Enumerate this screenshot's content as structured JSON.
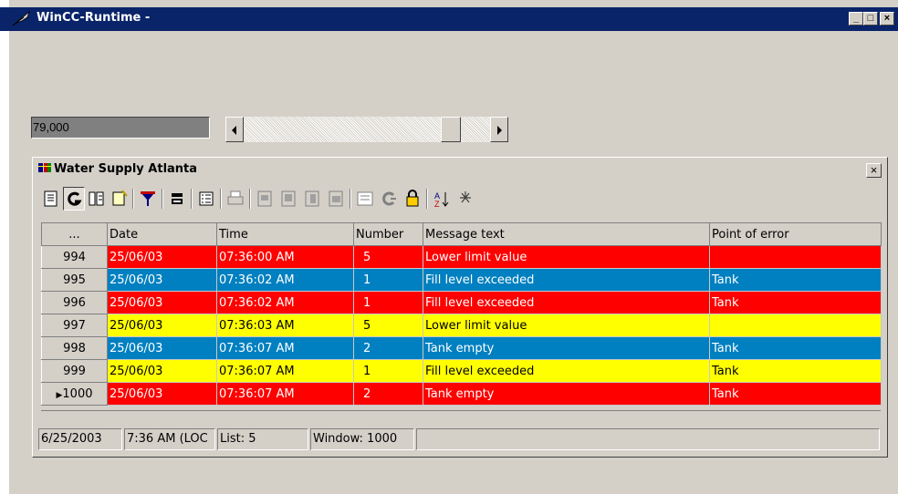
{
  "window": {
    "title": "WinCC-Runtime -",
    "minimize": "_",
    "maximize": "□",
    "close": "×"
  },
  "value_display": "79,000",
  "slider": {
    "value_fraction": 0.8
  },
  "alarm_window": {
    "title": "Water Supply Atlanta",
    "close": "×",
    "toolbar": [
      "message-list-icon",
      "history-icon",
      "journal-icon",
      "hitlist-icon",
      "filter-icon",
      "acknowledge-icon",
      "selection-icon",
      "print-icon",
      "lock-icon-1",
      "lock-icon-2",
      "lock-icon-3",
      "lock-icon-4",
      "report-icon",
      "loop-icon",
      "key-icon",
      "sort-icon",
      "timebase-icon"
    ],
    "columns": [
      "...",
      "Date",
      "Time",
      "Number",
      "Message text",
      "Point of error"
    ],
    "rows": [
      {
        "no": "994",
        "date": "25/06/03",
        "time": "07:36:00 AM",
        "number": "5",
        "text": "Lower limit value",
        "point": "",
        "color": "red"
      },
      {
        "no": "995",
        "date": "25/06/03",
        "time": "07:36:02 AM",
        "number": "1",
        "text": "Fill level exceeded",
        "point": "Tank",
        "color": "blue"
      },
      {
        "no": "996",
        "date": "25/06/03",
        "time": "07:36:02 AM",
        "number": "1",
        "text": "Fill level exceeded",
        "point": "Tank",
        "color": "red"
      },
      {
        "no": "997",
        "date": "25/06/03",
        "time": "07:36:03 AM",
        "number": "5",
        "text": "Lower limit value",
        "point": "",
        "color": "yellow"
      },
      {
        "no": "998",
        "date": "25/06/03",
        "time": "07:36:07 AM",
        "number": "2",
        "text": "Tank empty",
        "point": "Tank",
        "color": "blue"
      },
      {
        "no": "999",
        "date": "25/06/03",
        "time": "07:36:07 AM",
        "number": "1",
        "text": "Fill level exceeded",
        "point": "Tank",
        "color": "yellow"
      },
      {
        "no": "1000",
        "date": "25/06/03",
        "time": "07:36:07 AM",
        "number": "2",
        "text": "Tank empty",
        "point": "Tank",
        "color": "red",
        "selected": true
      }
    ],
    "row_marker": "▶",
    "status": {
      "date": "6/25/2003",
      "time": "7:36 AM (LOC",
      "list": "List: 5",
      "window": "Window: 1000",
      "extra": ""
    }
  },
  "colors": {
    "red": "#ff0000",
    "blue": "#0080c0",
    "yellow": "#ffff00",
    "titlebar": "#0a246a",
    "face": "#d4d0c8"
  }
}
